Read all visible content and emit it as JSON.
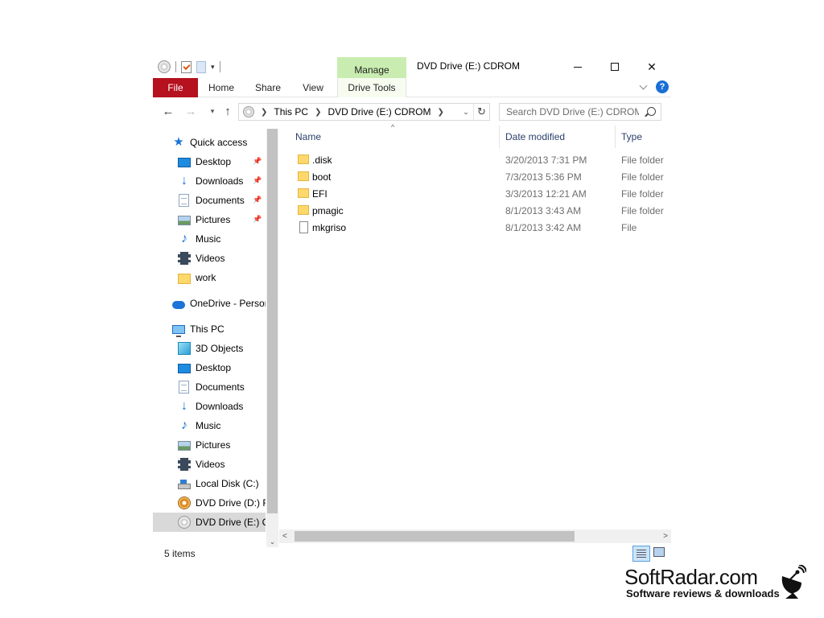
{
  "window": {
    "title": "DVD Drive (E:) CDROM",
    "contextual_tab_group": "Manage"
  },
  "ribbon": {
    "tabs": [
      {
        "label": "File"
      },
      {
        "label": "Home"
      },
      {
        "label": "Share"
      },
      {
        "label": "View"
      },
      {
        "label": "Drive Tools"
      }
    ],
    "help_label": "?"
  },
  "address": {
    "crumbs": [
      "This PC",
      "DVD Drive (E:) CDROM"
    ]
  },
  "search": {
    "placeholder": "Search DVD Drive (E:) CDROM"
  },
  "sidebar": {
    "items": [
      {
        "label": "Quick access",
        "icon": "star-icon"
      },
      {
        "label": "Desktop",
        "icon": "desktop-icon",
        "pinned": true
      },
      {
        "label": "Downloads",
        "icon": "download-arrow-icon",
        "pinned": true
      },
      {
        "label": "Documents",
        "icon": "document-icon",
        "pinned": true
      },
      {
        "label": "Pictures",
        "icon": "pictures-icon",
        "pinned": true
      },
      {
        "label": "Music",
        "icon": "music-note-icon"
      },
      {
        "label": "Videos",
        "icon": "film-strip-icon"
      },
      {
        "label": "work",
        "icon": "folder-icon"
      },
      {
        "label": "OneDrive - Persor",
        "icon": "cloud-icon"
      },
      {
        "label": "This PC",
        "icon": "computer-icon"
      },
      {
        "label": "3D Objects",
        "icon": "cube-icon"
      },
      {
        "label": "Desktop",
        "icon": "desktop-icon"
      },
      {
        "label": "Documents",
        "icon": "document-icon"
      },
      {
        "label": "Downloads",
        "icon": "download-arrow-icon"
      },
      {
        "label": "Music",
        "icon": "music-note-icon"
      },
      {
        "label": "Pictures",
        "icon": "pictures-icon"
      },
      {
        "label": "Videos",
        "icon": "film-strip-icon"
      },
      {
        "label": "Local Disk (C:)",
        "icon": "hard-disk-icon"
      },
      {
        "label": "DVD Drive (D:) R",
        "icon": "dvd-drive-icon"
      },
      {
        "label": "DVD Drive (E:) CI",
        "icon": "cd-drive-icon",
        "selected": true
      }
    ]
  },
  "columns": {
    "name": "Name",
    "date": "Date modified",
    "type": "Type"
  },
  "files": [
    {
      "name": ".disk",
      "date": "3/20/2013 7:31 PM",
      "type": "File folder",
      "kind": "folder"
    },
    {
      "name": "boot",
      "date": "7/3/2013 5:36 PM",
      "type": "File folder",
      "kind": "folder"
    },
    {
      "name": "EFI",
      "date": "3/3/2013 12:21 AM",
      "type": "File folder",
      "kind": "folder"
    },
    {
      "name": "pmagic",
      "date": "8/1/2013 3:43 AM",
      "type": "File folder",
      "kind": "folder"
    },
    {
      "name": "mkgriso",
      "date": "8/1/2013 3:42 AM",
      "type": "File",
      "kind": "file"
    }
  ],
  "status": {
    "item_count": "5 items"
  },
  "watermark": {
    "brand": "SoftRadar.com",
    "tagline": "Software reviews & downloads"
  },
  "colors": {
    "file_tab": "#b5111e",
    "manage_tab": "#c9edb0",
    "folder": "#ffd86b",
    "selection": "#d9d9d9",
    "help": "#1a6fd6"
  }
}
